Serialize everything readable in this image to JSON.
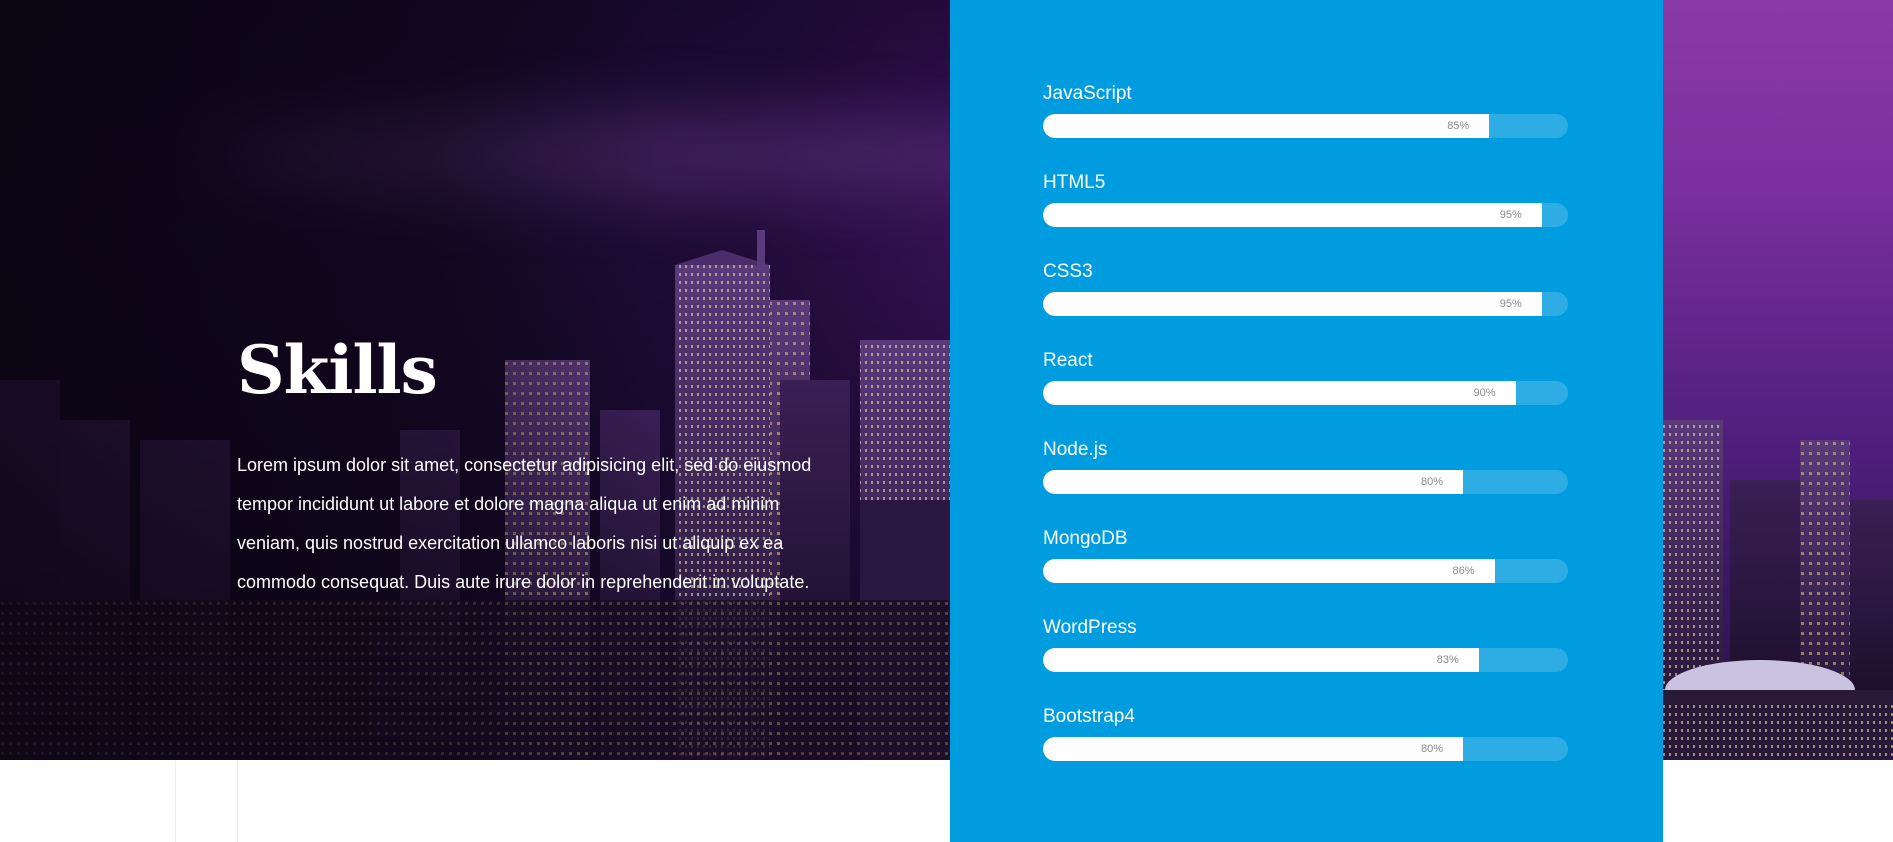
{
  "intro": {
    "title": "Skills",
    "body": "Lorem ipsum dolor sit amet, consectetur adipisicing elit, sed do eiusmod tempor incididunt ut labore et dolore magna aliqua ut enim ad minim veniam, quis nostrud exercitation ullamco laboris nisi ut aliquip ex ea commodo consequat. Duis aute irure dolor in reprehenderit in voluptate."
  },
  "skills": [
    {
      "name": "JavaScript",
      "percent_label": "85%",
      "level": 0.85
    },
    {
      "name": "HTML5",
      "percent_label": "95%",
      "level": 0.95
    },
    {
      "name": "CSS3",
      "percent_label": "95%",
      "level": 0.95
    },
    {
      "name": "React",
      "percent_label": "90%",
      "level": 0.9
    },
    {
      "name": "Node.js",
      "percent_label": "80%",
      "level": 0.8
    },
    {
      "name": "MongoDB",
      "percent_label": "86%",
      "level": 0.86
    },
    {
      "name": "WordPress",
      "percent_label": "83%",
      "level": 0.83
    },
    {
      "name": "Bootstrap4",
      "percent_label": "80%",
      "level": 0.8
    }
  ],
  "colors": {
    "panel": "#009ce0",
    "bar_fill": "#ffffff",
    "hero_dark": "#1e0b2e",
    "hero_purple": "#4a1970"
  }
}
